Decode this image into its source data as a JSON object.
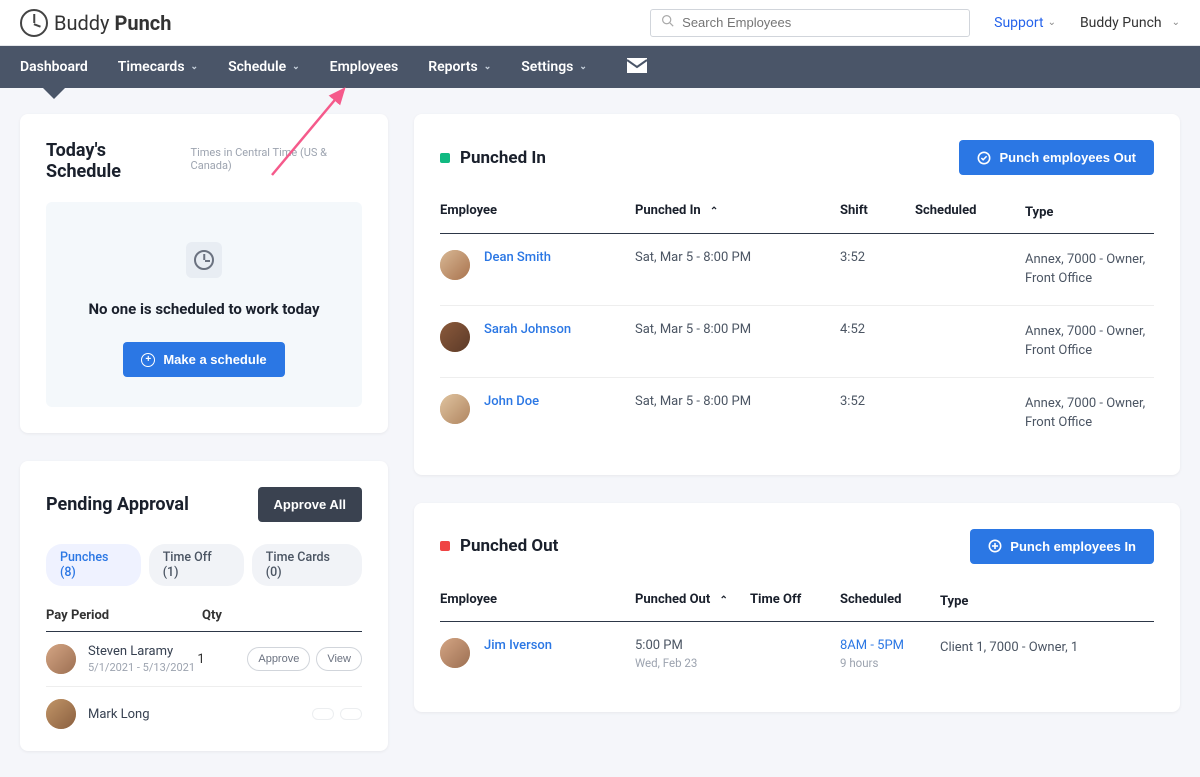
{
  "header": {
    "logo_primary": "Buddy",
    "logo_secondary": "Punch",
    "search_placeholder": "Search Employees",
    "support": "Support",
    "account": "Buddy Punch"
  },
  "nav": {
    "dashboard": "Dashboard",
    "timecards": "Timecards",
    "schedule": "Schedule",
    "employees": "Employees",
    "reports": "Reports",
    "settings": "Settings"
  },
  "schedule": {
    "title": "Today's Schedule",
    "subtitle": "Times in Central Time (US & Canada)",
    "empty_msg": "No one is scheduled to work today",
    "make_btn": "Make a schedule"
  },
  "pending": {
    "title": "Pending Approval",
    "approve_all": "Approve All",
    "tab_punches": "Punches (8)",
    "tab_timeoff": "Time Off (1)",
    "tab_timecards": "Time Cards (0)",
    "col_pay": "Pay Period",
    "col_qty": "Qty",
    "rows": [
      {
        "name": "Steven Laramy",
        "date": "5/1/2021 - 5/13/2021",
        "qty": "1"
      },
      {
        "name": "Mark Long",
        "date": "",
        "qty": ""
      }
    ],
    "approve": "Approve",
    "view": "View"
  },
  "punched_in": {
    "title": "Punched In",
    "btn": "Punch employees Out",
    "cols": {
      "emp": "Employee",
      "time": "Punched In",
      "shift": "Shift",
      "sched": "Scheduled",
      "type": "Type"
    },
    "rows": [
      {
        "name": "Dean Smith",
        "time": "Sat, Mar 5 - 8:00 PM",
        "shift": "3:52",
        "sched": "",
        "type": "Annex, 7000 - Owner, Front Office"
      },
      {
        "name": "Sarah Johnson",
        "time": "Sat, Mar 5 - 8:00 PM",
        "shift": "4:52",
        "sched": "",
        "type": "Annex, 7000 - Owner, Front Office"
      },
      {
        "name": "John Doe",
        "time": "Sat, Mar 5 - 8:00 PM",
        "shift": "3:52",
        "sched": "",
        "type": "Annex, 7000 - Owner, Front Office"
      }
    ]
  },
  "punched_out": {
    "title": "Punched Out",
    "btn": "Punch employees In",
    "cols": {
      "emp": "Employee",
      "time": "Punched Out",
      "timeoff": "Time Off",
      "sched": "Scheduled",
      "type": "Type"
    },
    "rows": [
      {
        "name": "Jim Iverson",
        "time": "5:00 PM",
        "time_sub": "Wed, Feb 23",
        "timeoff": "",
        "sched": "8AM - 5PM",
        "sched_sub": "9 hours",
        "type": "Client 1, 7000 - Owner, 1"
      }
    ]
  }
}
